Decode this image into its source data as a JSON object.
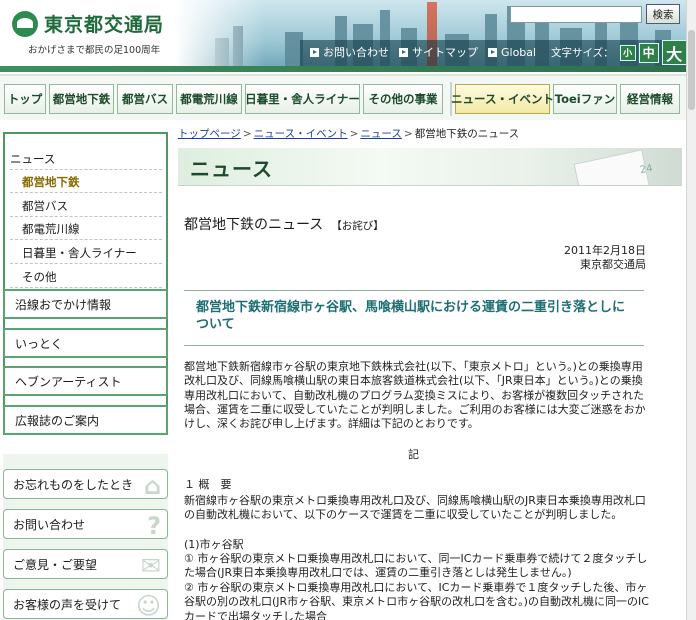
{
  "header": {
    "logo_text": "東京都交通局",
    "logo_subtitle": "おかげさまで都民の足100周年",
    "search_button": "検索",
    "util_links": [
      "お問い合わせ",
      "サイトマップ",
      "Global"
    ],
    "font_size_label": "文字サイズ：",
    "font_sizes": [
      "小",
      "中",
      "大"
    ]
  },
  "global_nav": [
    "トップ",
    "都営地下鉄",
    "都営バス",
    "都電荒川線",
    "日暮里・舎人ライナー",
    "その他の事業",
    "ニュース・イベント",
    "Toeiファン",
    "経営情報"
  ],
  "sidebar": {
    "local_nav": [
      "ニュース",
      "都営地下鉄",
      "都営バス",
      "都電荒川線",
      "日暮里・舎人ライナー",
      "その他"
    ],
    "buttons": [
      "沿線おでかけ情報",
      "いっとく",
      "ヘブンアーティスト",
      "広報誌のご案内"
    ],
    "sub_buttons": [
      "お忘れものをしたとき",
      "お問い合わせ",
      "ご意見・ご要望",
      "お客様の声を受けて"
    ]
  },
  "breadcrumb": {
    "items": [
      "トップページ",
      "ニュース・イベント",
      "ニュース"
    ],
    "current": "都営地下鉄のニュース"
  },
  "main": {
    "banner_title": "ニュース",
    "banner_deco_number": "24",
    "news_title": "都営地下鉄のニュース",
    "news_tag": "【お詫び】",
    "date": "2011年2月18日",
    "publisher": "東京都交通局",
    "headline": "都営地下鉄新宿線市ヶ谷駅、馬喰横山駅における運賃の二重引き落としについて",
    "body": "都営地下鉄新宿線市ヶ谷駅の東京地下鉄株式会社(以下、「東京メトロ」という。)との乗換専用改札口及び、同線馬喰横山駅の東日本旅客鉄道株式会社(以下、「JR東日本」という。)との乗換専用改札口において、自動改札機のプログラム変換ミスにより、お客様が複数回タッチされた場合、運賃を二重に収受していたことが判明しました。ご利用のお客様には大変ご迷惑をおかけし、深くお詫び申し上げます。詳細は下記のとおりです。",
    "ki": "記",
    "section_head": "１ 概　要",
    "section_para": "新宿線市ヶ谷駅の東京メトロ乗換専用改札口及び、同線馬喰横山駅のJR東日本乗換専用改札口の自動改札機において、以下のケースで運賃を二重に収受していたことが判明しました。",
    "sub_head": "(1)市ヶ谷駅",
    "sub_1": "① 市ヶ谷駅の東京メトロ乗換専用改札口において、同一ICカード乗車券で続けて２度タッチした場合(JR東日本乗換専用改札口では、運賃の二重引き落としは発生しません。)",
    "sub_2": "② 市ヶ谷駅の東京メトロ乗換専用改札口において、ICカード乗車券で１度タッチした後、市ヶ谷駅の別の改札口(JR市ヶ谷駅、東京メトロ市ヶ谷駅の改札口を含む。)の自動改札機に同一のICカードで出場タッチした場合"
  }
}
